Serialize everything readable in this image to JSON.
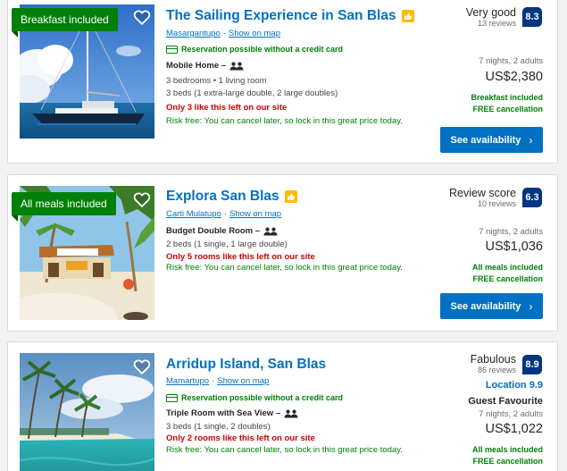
{
  "colors": {
    "link": "#0071c2",
    "green": "#008009",
    "score": "#003580",
    "scarcity": "#cc0000",
    "button": "#0071c2",
    "badge": "#febb02"
  },
  "icons": {
    "favorite": "heart-outline-icon",
    "preferred": "thumbs-up-icon",
    "occupancy": "two-persons-icon",
    "card": "credit-card-icon",
    "cta": "chevron-right-icon"
  },
  "listings": [
    {
      "ribbon": "Breakfast included",
      "title": "The Sailing Experience in San Blas",
      "location": "Masargantupo",
      "location_sep": "·",
      "map_link": "Show on map",
      "no_cc": "Reservation possible without a credit card",
      "room": "Mobile Home –",
      "details": [
        "3 bedrooms • 1 living room",
        "3 beds (1 extra-large double, 2 large doubles)"
      ],
      "scarcity": "Only 3 like this left on our site",
      "risk_free": "Risk free: You can cancel later, so lock in this great price today.",
      "score_word": "Very good",
      "reviews": "13 reviews",
      "score": "8.3",
      "stay": "7 nights, 2 adults",
      "price": "US$2,380",
      "perks": [
        "Breakfast included",
        "FREE cancellation"
      ],
      "cta": "See availability",
      "cta_chevron": "›"
    },
    {
      "ribbon": "All meals included",
      "title": "Explora San Blas",
      "location": "Carti Mulatupo",
      "location_sep": "·",
      "map_link": "Show on map",
      "room": "Budget Double Room –",
      "details": [
        "2 beds (1 single, 1 large double)"
      ],
      "scarcity": "Only 5 rooms like this left on our site",
      "risk_free": "Risk free: You can cancel later, so lock in this great price today.",
      "score_word": "Review score",
      "reviews": "10 reviews",
      "score": "6.3",
      "stay": "7 nights, 2 adults",
      "price": "US$1,036",
      "perks": [
        "All meals included",
        "FREE cancellation"
      ],
      "cta": "See availability",
      "cta_chevron": "›"
    },
    {
      "title": "Arridup Island, San Blas",
      "location": "Mamartupo",
      "location_sep": "·",
      "map_link": "Show on map",
      "no_cc": "Reservation possible without a credit card",
      "room": "Triple Room with Sea View –",
      "details": [
        "3 beds (1 single, 2 doubles)"
      ],
      "scarcity": "Only 2 rooms like this left on our site",
      "risk_free": "Risk free: You can cancel later, so lock in this great price today.",
      "score_word": "Fabulous",
      "reviews": "86 reviews",
      "score": "8.9",
      "location_score": "Location 9.9",
      "guest_fav": "Guest Favourite",
      "stay": "7 nights, 2 adults",
      "price": "US$1,022",
      "perks": [
        "All meals included",
        "FREE cancellation"
      ]
    }
  ]
}
